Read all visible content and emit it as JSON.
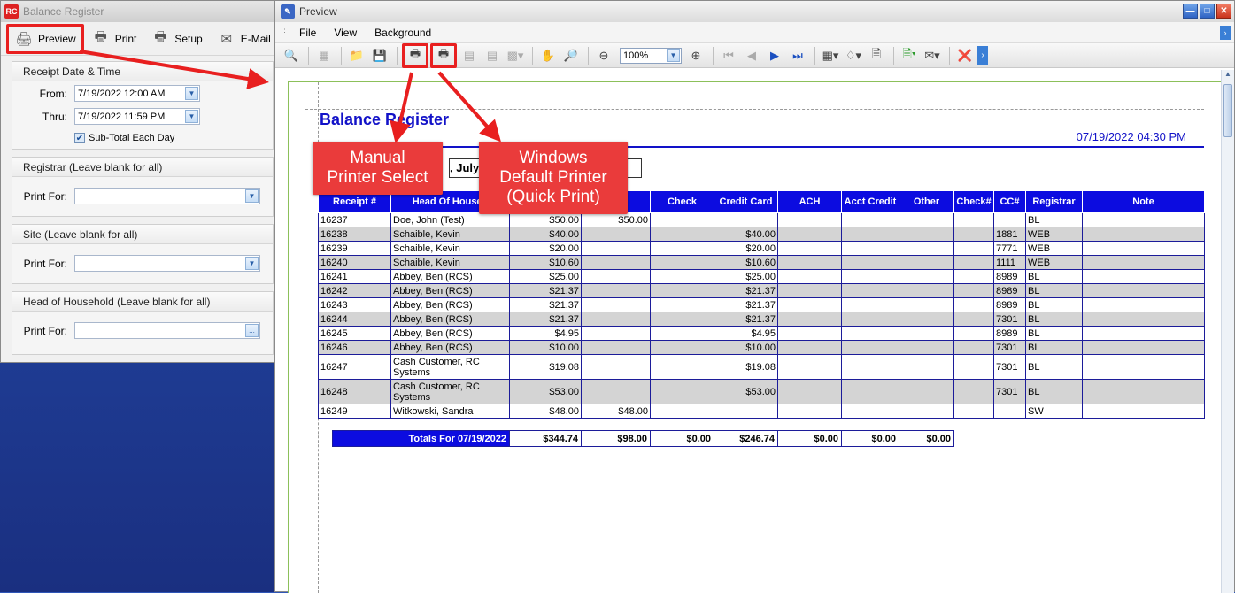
{
  "left_window": {
    "title": "Balance Register",
    "app_icon": "RC",
    "toolbar": [
      {
        "label": "Preview",
        "icon": "preview-icon"
      },
      {
        "label": "Print",
        "icon": "printer-icon"
      },
      {
        "label": "Setup",
        "icon": "printer-setup-icon"
      },
      {
        "label": "E-Mail",
        "icon": "email-icon"
      }
    ],
    "receipt_group": {
      "title": "Receipt Date & Time",
      "from_label": "From:",
      "from_value": "7/19/2022 12:00 AM",
      "thru_label": "Thru:",
      "thru_value": "7/19/2022 11:59 PM",
      "subtotal_label": "Sub-Total Each Day",
      "subtotal_checked": true
    },
    "registrar_group": {
      "title": "Registrar (Leave blank for all)",
      "print_for_label": "Print For:",
      "value": ""
    },
    "site_group": {
      "title": "Site (Leave blank for all)",
      "print_for_label": "Print For:",
      "value": ""
    },
    "household_group": {
      "title": "Head of Household (Leave blank for all)",
      "print_for_label": "Print For:",
      "value": "",
      "ellipsis": "..."
    }
  },
  "preview_window": {
    "title": "Preview",
    "menu": [
      "File",
      "View",
      "Background"
    ],
    "zoom": "100%",
    "report": {
      "title": "Balance Register",
      "datetime": "07/19/2022 04:30 PM",
      "subheading": ", July 1",
      "columns": [
        "Receipt #",
        "Head Of Househ",
        "",
        "",
        "Check",
        "Credit Card",
        "ACH",
        "Acct Credit",
        "Other",
        "Check#",
        "CC#",
        "Registrar",
        "Note"
      ],
      "rows": [
        [
          "16237",
          "Doe, John (Test)",
          "$50.00",
          "$50.00",
          "",
          "",
          "",
          "",
          "",
          "",
          "",
          "BL",
          ""
        ],
        [
          "16238",
          "Schaible, Kevin",
          "$40.00",
          "",
          "",
          "$40.00",
          "",
          "",
          "",
          "",
          "1881",
          "WEB",
          ""
        ],
        [
          "16239",
          "Schaible, Kevin",
          "$20.00",
          "",
          "",
          "$20.00",
          "",
          "",
          "",
          "",
          "7771",
          "WEB",
          ""
        ],
        [
          "16240",
          "Schaible, Kevin",
          "$10.60",
          "",
          "",
          "$10.60",
          "",
          "",
          "",
          "",
          "1111",
          "WEB",
          ""
        ],
        [
          "16241",
          "Abbey, Ben (RCS)",
          "$25.00",
          "",
          "",
          "$25.00",
          "",
          "",
          "",
          "",
          "8989",
          "BL",
          ""
        ],
        [
          "16242",
          "Abbey, Ben (RCS)",
          "$21.37",
          "",
          "",
          "$21.37",
          "",
          "",
          "",
          "",
          "8989",
          "BL",
          ""
        ],
        [
          "16243",
          "Abbey, Ben (RCS)",
          "$21.37",
          "",
          "",
          "$21.37",
          "",
          "",
          "",
          "",
          "8989",
          "BL",
          ""
        ],
        [
          "16244",
          "Abbey, Ben (RCS)",
          "$21.37",
          "",
          "",
          "$21.37",
          "",
          "",
          "",
          "",
          "7301",
          "BL",
          ""
        ],
        [
          "16245",
          "Abbey, Ben (RCS)",
          "$4.95",
          "",
          "",
          "$4.95",
          "",
          "",
          "",
          "",
          "8989",
          "BL",
          ""
        ],
        [
          "16246",
          "Abbey, Ben (RCS)",
          "$10.00",
          "",
          "",
          "$10.00",
          "",
          "",
          "",
          "",
          "7301",
          "BL",
          ""
        ],
        [
          "16247",
          "Cash Customer, RC Systems",
          "$19.08",
          "",
          "",
          "$19.08",
          "",
          "",
          "",
          "",
          "7301",
          "BL",
          ""
        ],
        [
          "16248",
          "Cash Customer, RC Systems",
          "$53.00",
          "",
          "",
          "$53.00",
          "",
          "",
          "",
          "",
          "7301",
          "BL",
          ""
        ],
        [
          "16249",
          "Witkowski, Sandra",
          "$48.00",
          "$48.00",
          "",
          "",
          "",
          "",
          "",
          "",
          "",
          "SW",
          ""
        ]
      ],
      "totals": {
        "label": "Totals For 07/19/2022",
        "values": [
          "$344.74",
          "$98.00",
          "$0.00",
          "$246.74",
          "$0.00",
          "$0.00",
          "$0.00"
        ]
      }
    }
  },
  "callouts": {
    "manual": "Manual Printer Select",
    "manual_l1": "Manual",
    "manual_l2": "Printer Select",
    "quick_l1": "Windows",
    "quick_l2": "Default Printer",
    "quick_l3": "(Quick Print)"
  },
  "colors": {
    "report_blue": "#0c0ce0",
    "callout_red": "#ea3b3b",
    "highlight_red": "#e81f1f"
  }
}
